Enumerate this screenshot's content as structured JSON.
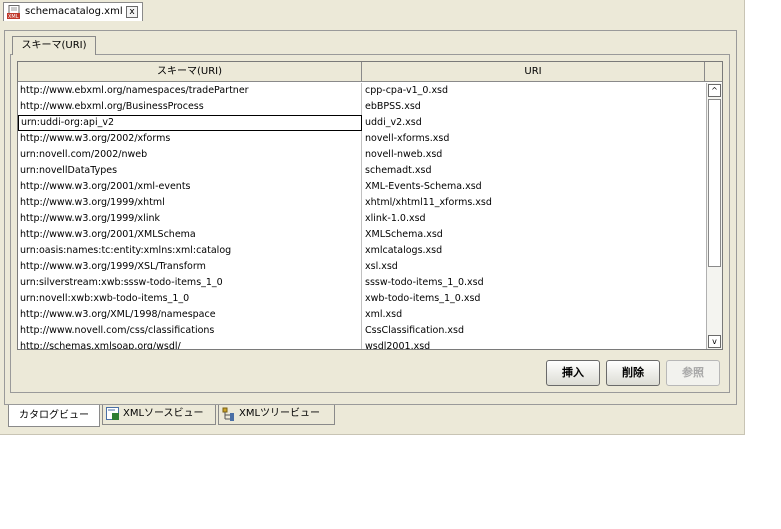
{
  "file_tab": {
    "name": "schemacatalog.xml",
    "close": "x"
  },
  "inner_tab": "スキーマ(URI)",
  "table": {
    "headers": [
      "スキーマ(URI)",
      "URI"
    ],
    "rows": [
      [
        "http://www.ebxml.org/namespaces/tradePartner",
        "cpp-cpa-v1_0.xsd"
      ],
      [
        "http://www.ebxml.org/BusinessProcess",
        "ebBPSS.xsd"
      ],
      [
        "urn:uddi-org:api_v2",
        "uddi_v2.xsd"
      ],
      [
        "http://www.w3.org/2002/xforms",
        "novell-xforms.xsd"
      ],
      [
        "urn:novell.com/2002/nweb",
        "novell-nweb.xsd"
      ],
      [
        "urn:novellDataTypes",
        "schemadt.xsd"
      ],
      [
        "http://www.w3.org/2001/xml-events",
        "XML-Events-Schema.xsd"
      ],
      [
        "http://www.w3.org/1999/xhtml",
        "xhtml/xhtml11_xforms.xsd"
      ],
      [
        "http://www.w3.org/1999/xlink",
        "xlink-1.0.xsd"
      ],
      [
        "http://www.w3.org/2001/XMLSchema",
        "XMLSchema.xsd"
      ],
      [
        "urn:oasis:names:tc:entity:xmlns:xml:catalog",
        "xmlcatalogs.xsd"
      ],
      [
        "http://www.w3.org/1999/XSL/Transform",
        "xsl.xsd"
      ],
      [
        "urn:silverstream:xwb:sssw-todo-items_1_0",
        "sssw-todo-items_1_0.xsd"
      ],
      [
        "urn:novell:xwb:xwb-todo-items_1_0",
        "xwb-todo-items_1_0.xsd"
      ],
      [
        "http://www.w3.org/XML/1998/namespace",
        "xml.xsd"
      ],
      [
        "http://www.novell.com/css/classifications",
        "CssClassification.xsd"
      ],
      [
        "http://schemas.xmlsoap.org/wsdl/",
        "wsdl2001.xsd"
      ]
    ],
    "selected_row": 2,
    "scroll_up": "^",
    "scroll_down": "v"
  },
  "buttons": {
    "insert": "挿入",
    "delete": "削除",
    "reference": "参照"
  },
  "bottom_tabs": {
    "catalog": "カタログビュー",
    "source": "XMLソースビュー",
    "tree": "XMLツリービュー"
  }
}
